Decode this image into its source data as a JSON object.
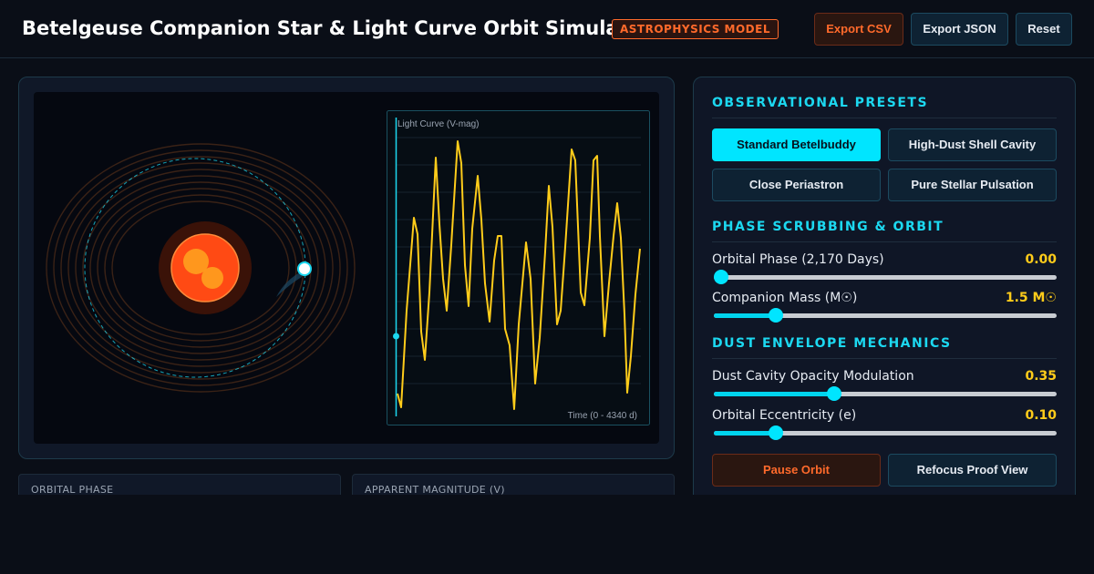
{
  "header": {
    "title": "Betelgeuse Companion Star & Light Curve Orbit Simulator",
    "badge": "ASTROPHYSICS MODEL",
    "export_csv_label": "Export CSV",
    "export_json_label": "Export JSON",
    "reset_label": "Reset"
  },
  "visualization": {
    "light_curve_title": "Light Curve (V-mag)",
    "light_curve_axis": "Time (0 - 4340 d)",
    "light_curve_color": "#ffcc1a",
    "orbit_color": "#1cd8f0",
    "star_color": "#ff4a14"
  },
  "stats": {
    "phase_label": "ORBITAL PHASE",
    "magnitude_label": "APPARENT MAGNITUDE (V)"
  },
  "controls": {
    "presets_title": "OBSERVATIONAL PRESETS",
    "presets": [
      {
        "label": "Standard Betelbuddy",
        "active": true
      },
      {
        "label": "High-Dust Shell Cavity",
        "active": false
      },
      {
        "label": "Close Periastron",
        "active": false
      },
      {
        "label": "Pure Stellar Pulsation",
        "active": false
      }
    ],
    "phase_title": "PHASE SCRUBBING & ORBIT",
    "dust_title": "DUST ENVELOPE MECHANICS",
    "sliders": {
      "phase": {
        "label": "Orbital Phase (2,170 Days)",
        "value": "0.00",
        "fraction": 0.0
      },
      "mass": {
        "label": "Companion Mass (M☉)",
        "value": "1.5 M☉",
        "fraction": 0.18
      },
      "opacity": {
        "label": "Dust Cavity Opacity Modulation",
        "value": "0.35",
        "fraction": 0.35
      },
      "eccentricity": {
        "label": "Orbital Eccentricity (e)",
        "value": "0.10",
        "fraction": 0.18
      }
    },
    "pause_label": "Pause Orbit",
    "refocus_label": "Refocus Proof View"
  }
}
